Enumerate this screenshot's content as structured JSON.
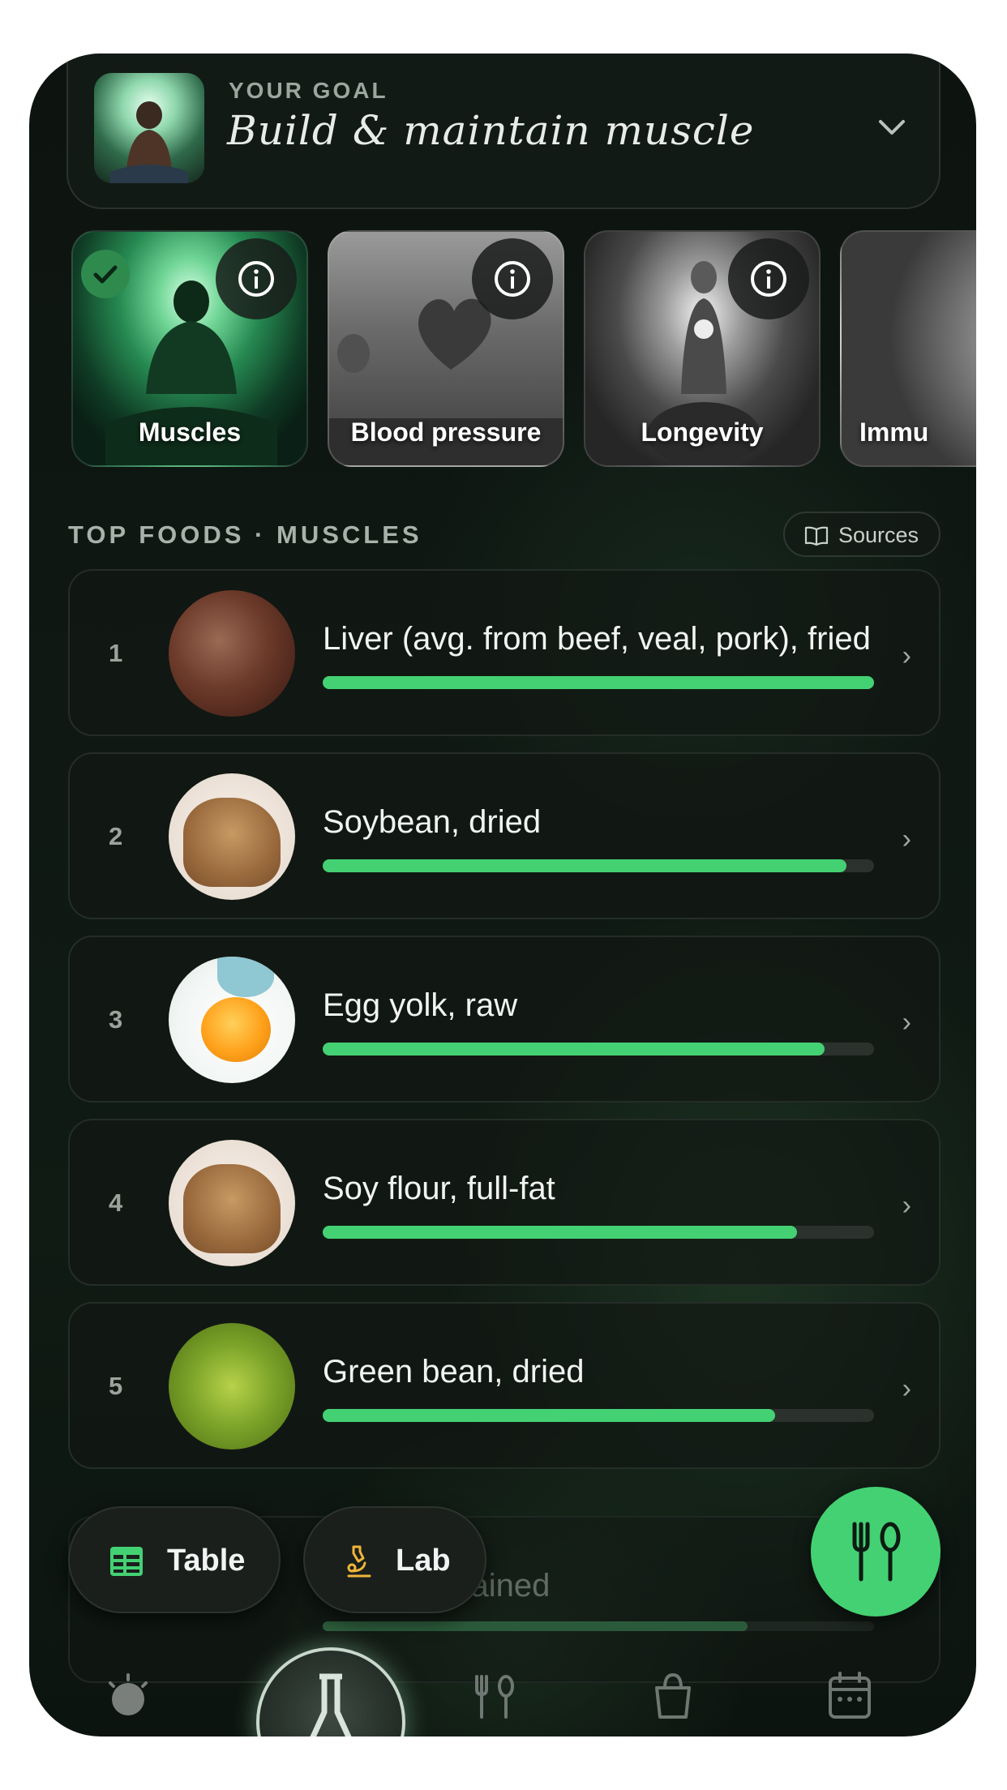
{
  "goal": {
    "label": "YOUR GOAL",
    "value": "Build & maintain muscle",
    "thumb_icon": "meditation-figure-image",
    "expand_icon": "chevron-down-icon"
  },
  "categories": [
    {
      "label": "Muscles",
      "selected": true,
      "icon": "info-icon"
    },
    {
      "label": "Blood pressure",
      "selected": false,
      "icon": "info-icon"
    },
    {
      "label": "Longevity",
      "selected": false,
      "icon": "info-icon"
    },
    {
      "label": "Immu",
      "selected": false
    }
  ],
  "section": {
    "title": "TOP FOODS · MUSCLES",
    "sources_label": "Sources",
    "sources_icon": "book-icon"
  },
  "foods": [
    {
      "rank": "1",
      "name": "Liver (avg. from beef, veal, pork), fried",
      "score": 1.0
    },
    {
      "rank": "2",
      "name": "Soybean, dried",
      "score": 0.95
    },
    {
      "rank": "3",
      "name": "Egg yolk, raw",
      "score": 0.91
    },
    {
      "rank": "4",
      "name": "Soy flour, full-fat",
      "score": 0.86
    },
    {
      "rank": "5",
      "name": "Green bean, dried",
      "score": 0.82
    },
    {
      "rank": "",
      "name": "n oil), drained",
      "score": 0.77
    }
  ],
  "actions": {
    "table_label": "Table",
    "lab_label": "Lab",
    "fab_icon": "fork-spoon-icon"
  },
  "nav": {
    "icons": [
      "sun-icon",
      "lab-flask-icon",
      "fork-spoon-icon",
      "shopping-bag-icon",
      "calendar-icon"
    ]
  },
  "colors": {
    "accent": "#44d173",
    "background": "#0f1813"
  }
}
